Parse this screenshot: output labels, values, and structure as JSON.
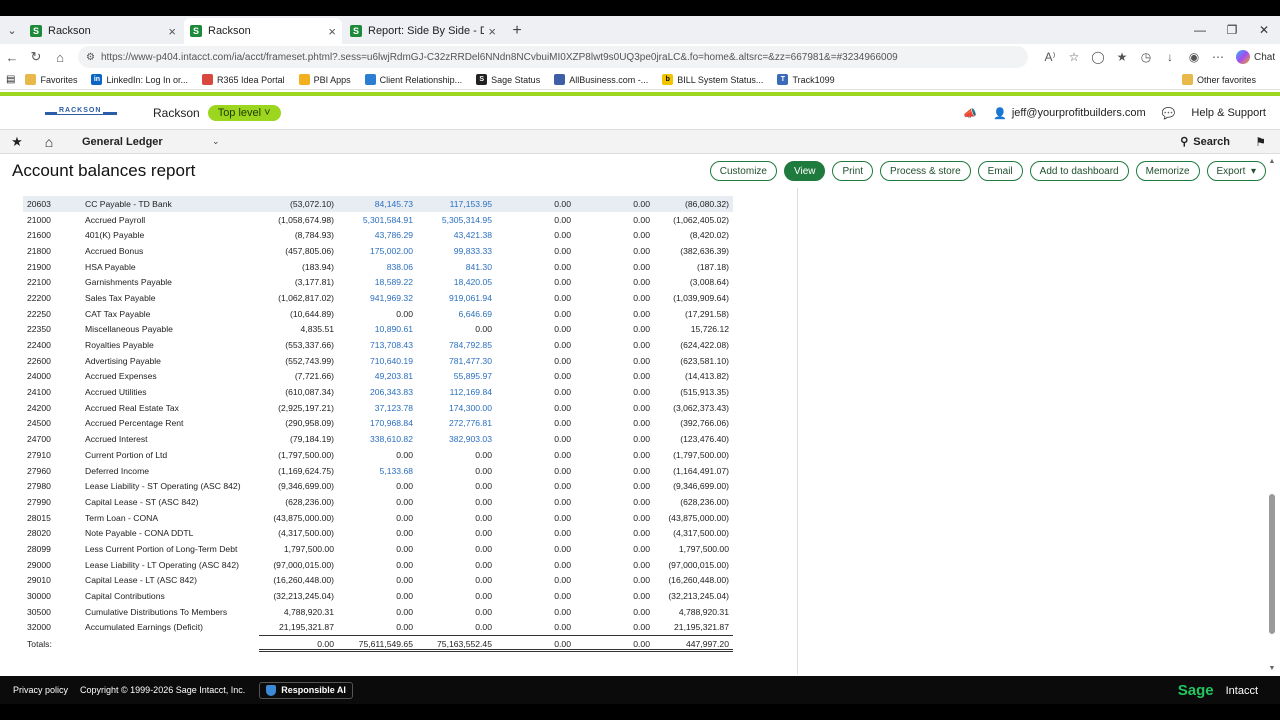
{
  "browser": {
    "tabs": [
      {
        "label": "Rackson",
        "active": false
      },
      {
        "label": "Rackson",
        "active": true
      },
      {
        "label": "Report: Side By Side - Detail - Peri",
        "active": false
      }
    ],
    "url": "https://www-p404.intacct.com/ia/acct/frameset.phtml?.sess=u6lwjRdmGJ-C32zRRDel6NNdn8NCvbuiMI0XZP8lwt9s0UQ3pe0jraLC&.fo=home&.altsrc=&zz=667981&=#3234966009",
    "chat_label": "Chat",
    "bookmarks": [
      {
        "label": "Favorites",
        "icon": "folder-icon",
        "color": "#e8b84a"
      },
      {
        "label": "LinkedIn: Log In or...",
        "icon": "linkedin-icon",
        "color": "#0a66c2"
      },
      {
        "label": "R365 Idea Portal",
        "icon": "r365-icon",
        "color": "#d9473f"
      },
      {
        "label": "PBI Apps",
        "icon": "grid-icon",
        "color": "#f2b01e"
      },
      {
        "label": "Client Relationship...",
        "icon": "crm-icon",
        "color": "#2a7dd1"
      },
      {
        "label": "Sage Status",
        "icon": "sage-icon",
        "color": "#222222"
      },
      {
        "label": "AllBusiness.com -...",
        "icon": "globe-icon",
        "color": "#3f5ea8"
      },
      {
        "label": "BILL System Status...",
        "icon": "bill-icon",
        "color": "#f2c400"
      },
      {
        "label": "Track1099",
        "icon": "track-icon",
        "color": "#3a6ab8"
      }
    ],
    "other_favorites": "Other favorites"
  },
  "header": {
    "logo_text": "RACKSON",
    "company": "Rackson",
    "level": "Top level",
    "user": "jeff@yourprofitbuilders.com",
    "help": "Help & Support"
  },
  "nav": {
    "module": "General Ledger",
    "search": "Search"
  },
  "page": {
    "title": "Account balances report",
    "actions": [
      "Customize",
      "View",
      "Print",
      "Process & store",
      "Email",
      "Add to dashboard",
      "Memorize",
      "Export"
    ]
  },
  "report": {
    "rows": [
      {
        "acct": "20603",
        "name": "CC Payable - TD Bank",
        "v": [
          "(53,072.10)",
          "84,145.73",
          "117,153.95",
          "0.00",
          "0.00",
          "(86,080.32)"
        ],
        "links": [
          false,
          true,
          true,
          false,
          false,
          false
        ],
        "hl": true
      },
      {
        "acct": "21000",
        "name": "Accrued Payroll",
        "v": [
          "(1,058,674.98)",
          "5,301,584.91",
          "5,305,314.95",
          "0.00",
          "0.00",
          "(1,062,405.02)"
        ],
        "links": [
          false,
          true,
          true,
          false,
          false,
          false
        ]
      },
      {
        "acct": "21600",
        "name": "401(K) Payable",
        "v": [
          "(8,784.93)",
          "43,786.29",
          "43,421.38",
          "0.00",
          "0.00",
          "(8,420.02)"
        ],
        "links": [
          false,
          true,
          true,
          false,
          false,
          false
        ]
      },
      {
        "acct": "21800",
        "name": "Accrued Bonus",
        "v": [
          "(457,805.06)",
          "175,002.00",
          "99,833.33",
          "0.00",
          "0.00",
          "(382,636.39)"
        ],
        "links": [
          false,
          true,
          true,
          false,
          false,
          false
        ]
      },
      {
        "acct": "21900",
        "name": "HSA Payable",
        "v": [
          "(183.94)",
          "838.06",
          "841.30",
          "0.00",
          "0.00",
          "(187.18)"
        ],
        "links": [
          false,
          true,
          true,
          false,
          false,
          false
        ]
      },
      {
        "acct": "22100",
        "name": "Garnishments Payable",
        "v": [
          "(3,177.81)",
          "18,589.22",
          "18,420.05",
          "0.00",
          "0.00",
          "(3,008.64)"
        ],
        "links": [
          false,
          true,
          true,
          false,
          false,
          false
        ]
      },
      {
        "acct": "22200",
        "name": "Sales Tax Payable",
        "v": [
          "(1,062,817.02)",
          "941,969.32",
          "919,061.94",
          "0.00",
          "0.00",
          "(1,039,909.64)"
        ],
        "links": [
          false,
          true,
          true,
          false,
          false,
          false
        ]
      },
      {
        "acct": "22250",
        "name": "CAT Tax Payable",
        "v": [
          "(10,644.89)",
          "0.00",
          "6,646.69",
          "0.00",
          "0.00",
          "(17,291.58)"
        ],
        "links": [
          false,
          false,
          true,
          false,
          false,
          false
        ]
      },
      {
        "acct": "22350",
        "name": "Miscellaneous Payable",
        "v": [
          "4,835.51",
          "10,890.61",
          "0.00",
          "0.00",
          "0.00",
          "15,726.12"
        ],
        "links": [
          false,
          true,
          false,
          false,
          false,
          false
        ]
      },
      {
        "acct": "22400",
        "name": "Royalties Payable",
        "v": [
          "(553,337.66)",
          "713,708.43",
          "784,792.85",
          "0.00",
          "0.00",
          "(624,422.08)"
        ],
        "links": [
          false,
          true,
          true,
          false,
          false,
          false
        ]
      },
      {
        "acct": "22600",
        "name": "Advertising Payable",
        "v": [
          "(552,743.99)",
          "710,640.19",
          "781,477.30",
          "0.00",
          "0.00",
          "(623,581.10)"
        ],
        "links": [
          false,
          true,
          true,
          false,
          false,
          false
        ]
      },
      {
        "acct": "24000",
        "name": "Accrued Expenses",
        "v": [
          "(7,721.66)",
          "49,203.81",
          "55,895.97",
          "0.00",
          "0.00",
          "(14,413.82)"
        ],
        "links": [
          false,
          true,
          true,
          false,
          false,
          false
        ]
      },
      {
        "acct": "24100",
        "name": "Accrued Utilities",
        "v": [
          "(610,087.34)",
          "206,343.83",
          "112,169.84",
          "0.00",
          "0.00",
          "(515,913.35)"
        ],
        "links": [
          false,
          true,
          true,
          false,
          false,
          false
        ]
      },
      {
        "acct": "24200",
        "name": "Accrued Real Estate Tax",
        "v": [
          "(2,925,197.21)",
          "37,123.78",
          "174,300.00",
          "0.00",
          "0.00",
          "(3,062,373.43)"
        ],
        "links": [
          false,
          true,
          true,
          false,
          false,
          false
        ]
      },
      {
        "acct": "24500",
        "name": "Accrued Percentage Rent",
        "v": [
          "(290,958.09)",
          "170,968.84",
          "272,776.81",
          "0.00",
          "0.00",
          "(392,766.06)"
        ],
        "links": [
          false,
          true,
          true,
          false,
          false,
          false
        ]
      },
      {
        "acct": "24700",
        "name": "Accrued Interest",
        "v": [
          "(79,184.19)",
          "338,610.82",
          "382,903.03",
          "0.00",
          "0.00",
          "(123,476.40)"
        ],
        "links": [
          false,
          true,
          true,
          false,
          false,
          false
        ]
      },
      {
        "acct": "27910",
        "name": "Current Portion of Ltd",
        "v": [
          "(1,797,500.00)",
          "0.00",
          "0.00",
          "0.00",
          "0.00",
          "(1,797,500.00)"
        ],
        "links": [
          false,
          false,
          false,
          false,
          false,
          false
        ]
      },
      {
        "acct": "27960",
        "name": "Deferred Income",
        "v": [
          "(1,169,624.75)",
          "5,133.68",
          "0.00",
          "0.00",
          "0.00",
          "(1,164,491.07)"
        ],
        "links": [
          false,
          true,
          false,
          false,
          false,
          false
        ]
      },
      {
        "acct": "27980",
        "name": "Lease Liability - ST Operating (ASC 842)",
        "v": [
          "(9,346,699.00)",
          "0.00",
          "0.00",
          "0.00",
          "0.00",
          "(9,346,699.00)"
        ],
        "links": [
          false,
          false,
          false,
          false,
          false,
          false
        ]
      },
      {
        "acct": "27990",
        "name": "Capital Lease - ST (ASC 842)",
        "v": [
          "(628,236.00)",
          "0.00",
          "0.00",
          "0.00",
          "0.00",
          "(628,236.00)"
        ],
        "links": [
          false,
          false,
          false,
          false,
          false,
          false
        ]
      },
      {
        "acct": "28015",
        "name": "Term Loan - CONA",
        "v": [
          "(43,875,000.00)",
          "0.00",
          "0.00",
          "0.00",
          "0.00",
          "(43,875,000.00)"
        ],
        "links": [
          false,
          false,
          false,
          false,
          false,
          false
        ]
      },
      {
        "acct": "28020",
        "name": "Note Payable - CONA DDTL",
        "v": [
          "(4,317,500.00)",
          "0.00",
          "0.00",
          "0.00",
          "0.00",
          "(4,317,500.00)"
        ],
        "links": [
          false,
          false,
          false,
          false,
          false,
          false
        ]
      },
      {
        "acct": "28099",
        "name": "Less Current Portion of Long-Term Debt",
        "v": [
          "1,797,500.00",
          "0.00",
          "0.00",
          "0.00",
          "0.00",
          "1,797,500.00"
        ],
        "links": [
          false,
          false,
          false,
          false,
          false,
          false
        ]
      },
      {
        "acct": "29000",
        "name": "Lease Liability - LT Operating (ASC 842)",
        "v": [
          "(97,000,015.00)",
          "0.00",
          "0.00",
          "0.00",
          "0.00",
          "(97,000,015.00)"
        ],
        "links": [
          false,
          false,
          false,
          false,
          false,
          false
        ]
      },
      {
        "acct": "29010",
        "name": "Capital Lease - LT (ASC 842)",
        "v": [
          "(16,260,448.00)",
          "0.00",
          "0.00",
          "0.00",
          "0.00",
          "(16,260,448.00)"
        ],
        "links": [
          false,
          false,
          false,
          false,
          false,
          false
        ]
      },
      {
        "acct": "30000",
        "name": "Capital Contributions",
        "v": [
          "(32,213,245.04)",
          "0.00",
          "0.00",
          "0.00",
          "0.00",
          "(32,213,245.04)"
        ],
        "links": [
          false,
          false,
          false,
          false,
          false,
          false
        ]
      },
      {
        "acct": "30500",
        "name": "Cumulative Distributions To Members",
        "v": [
          "4,788,920.31",
          "0.00",
          "0.00",
          "0.00",
          "0.00",
          "4,788,920.31"
        ],
        "links": [
          false,
          false,
          false,
          false,
          false,
          false
        ]
      },
      {
        "acct": "32000",
        "name": "Accumulated Earnings (Deficit)",
        "v": [
          "21,195,321.87",
          "0.00",
          "0.00",
          "0.00",
          "0.00",
          "21,195,321.87"
        ],
        "links": [
          false,
          false,
          false,
          false,
          false,
          false
        ]
      }
    ],
    "totals_label": "Totals:",
    "totals": [
      "0.00",
      "75,611,549.65",
      "75,163,552.45",
      "0.00",
      "0.00",
      "447,997.20"
    ]
  },
  "footer": {
    "privacy": "Privacy policy",
    "copyright": "Copyright © 1999-2026 Sage Intacct, Inc.",
    "responsible_ai": "Responsible AI",
    "brand_sage": "Sage",
    "brand_intacct": "Intacct"
  }
}
